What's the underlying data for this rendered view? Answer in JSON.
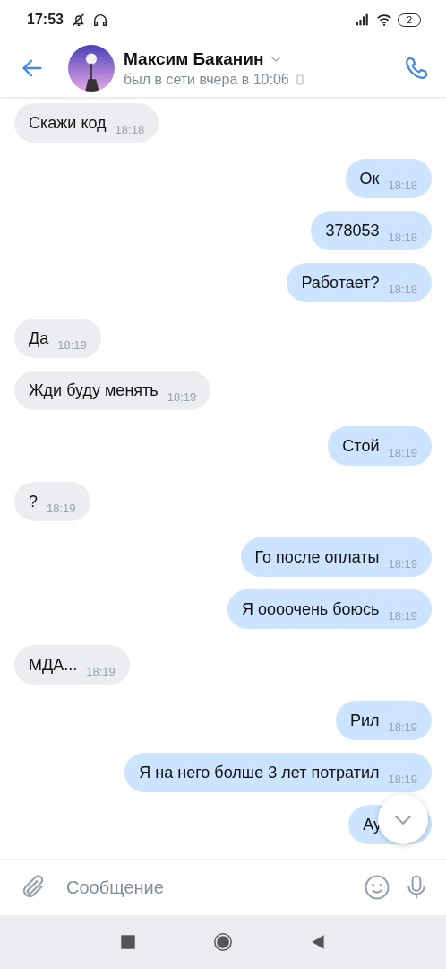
{
  "status_bar": {
    "time": "17:53",
    "battery": "2"
  },
  "header": {
    "name": "Максим Баканин",
    "status": "был в сети вчера в 10:06"
  },
  "messages": [
    {
      "kind": "in",
      "text": "Скажи код",
      "time": "18:18"
    },
    {
      "kind": "out",
      "text": "Ок",
      "time": "18:18"
    },
    {
      "kind": "out",
      "text": "378053",
      "time": "18:18"
    },
    {
      "kind": "out",
      "text": "Работает?",
      "time": "18:18"
    },
    {
      "kind": "in",
      "text": "Да",
      "time": "18:19"
    },
    {
      "kind": "in",
      "text": "Жди буду менять",
      "time": "18:19"
    },
    {
      "kind": "out",
      "text": "Стой",
      "time": "18:19"
    },
    {
      "kind": "in",
      "text": "?",
      "time": "18:19"
    },
    {
      "kind": "out",
      "text": "Го после оплаты",
      "time": "18:19"
    },
    {
      "kind": "out",
      "text": "Я оооочень боюсь",
      "time": "18:19"
    },
    {
      "kind": "in",
      "text": "МДА...",
      "time": "18:19"
    },
    {
      "kind": "out",
      "text": "Рил",
      "time": "18:19"
    },
    {
      "kind": "out",
      "text": "Я на него болше 3 лет потратил",
      "time": "18:19"
    },
    {
      "kind": "out",
      "text": "Ау"
    }
  ],
  "composer": {
    "placeholder": "Сообщение"
  }
}
